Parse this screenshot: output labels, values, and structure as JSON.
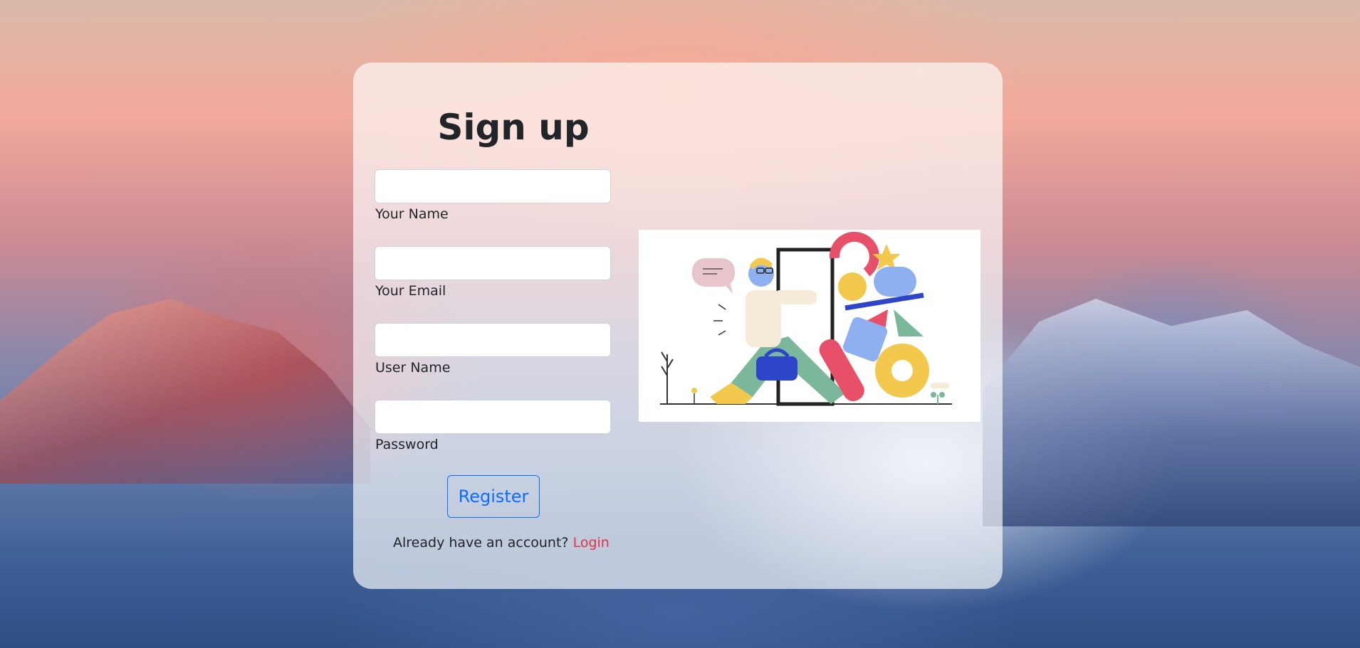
{
  "page": {
    "title": "Sign up"
  },
  "form": {
    "fields": [
      {
        "label": "Your Name",
        "value": "",
        "placeholder": ""
      },
      {
        "label": "Your Email",
        "value": "",
        "placeholder": ""
      },
      {
        "label": "User Name",
        "value": "",
        "placeholder": ""
      },
      {
        "label": "Password",
        "value": "",
        "placeholder": ""
      }
    ],
    "register_label": "Register",
    "login_prompt": "Already have an account?",
    "login_link": "Login"
  },
  "colors": {
    "primary": "#0d6efd",
    "link": "#dc3545",
    "text": "#212529"
  }
}
